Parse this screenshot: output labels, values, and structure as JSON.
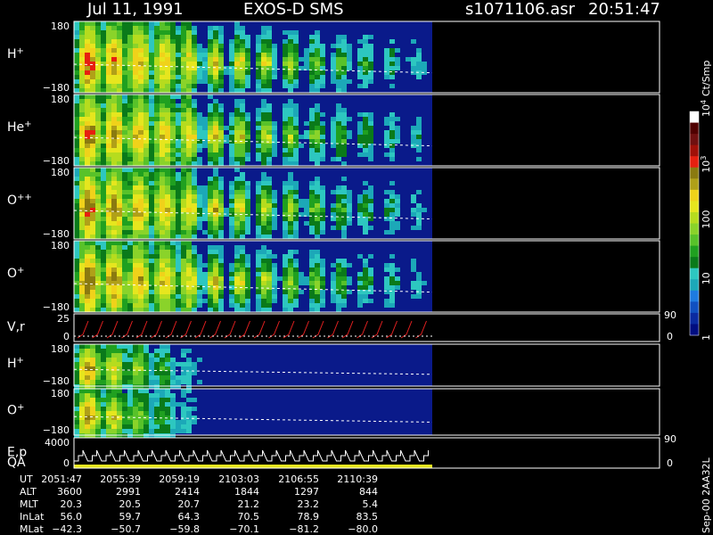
{
  "header": {
    "date": "Jul 11, 1991",
    "instrument": "EXOS-D SMS",
    "file": "s1071106.asr",
    "time": "20:51:47"
  },
  "colorbar": {
    "unit": "Ct/Smp",
    "ticks": [
      {
        "label": "1",
        "value": 1
      },
      {
        "label": "10",
        "value": 10
      },
      {
        "label": "100",
        "value": 100
      },
      {
        "label": "10",
        "sup": "3",
        "value": 1000
      },
      {
        "label": "10",
        "sup": "4",
        "value": 10000
      }
    ],
    "colors": [
      "#000d80",
      "#0a2aa0",
      "#1050c0",
      "#1e7be0",
      "#1ca8b8",
      "#2dc7c0",
      "#0a7a1a",
      "#20a020",
      "#58c22a",
      "#8ad32a",
      "#b6dc1e",
      "#e6e61e",
      "#f0d21a",
      "#b0a018",
      "#8a7a10",
      "#e62010",
      "#a01008",
      "#701010",
      "#500000",
      "#ffffff"
    ]
  },
  "panels": [
    {
      "id": "h-plus",
      "label": "H",
      "sup": "+",
      "ymax": "180",
      "ymin": "−180",
      "type": "spectrogram"
    },
    {
      "id": "he-plus",
      "label": "He",
      "sup": "+",
      "ymax": "180",
      "ymin": "−180",
      "type": "spectrogram"
    },
    {
      "id": "o-plus-plus",
      "label": "O",
      "sup": "++",
      "ymax": "180",
      "ymin": "−180",
      "type": "spectrogram"
    },
    {
      "id": "o-plus",
      "label": "O",
      "sup": "+",
      "ymax": "180",
      "ymin": "−180",
      "type": "spectrogram"
    },
    {
      "id": "vr",
      "label": "V,r",
      "sup": "",
      "ymax": "25",
      "ymin": "0",
      "right_top": "90",
      "right_bottom": "0",
      "type": "line"
    },
    {
      "id": "h-plus-2",
      "label": "H",
      "sup": "+",
      "ymax": "180",
      "ymin": "−180",
      "type": "spectrogram"
    },
    {
      "id": "o-plus-2",
      "label": "O",
      "sup": "+",
      "ymax": "180",
      "ymin": "−180",
      "type": "spectrogram"
    },
    {
      "id": "ep",
      "label": "E,p",
      "label2": "QA",
      "sup": "",
      "ymax": "4000",
      "ymin": "0",
      "right_top": "90",
      "right_bottom": "0",
      "type": "steps"
    }
  ],
  "side_note": "Sep-00 2AA32L",
  "table": {
    "rows": [
      {
        "name": "UT",
        "values": [
          "2051:47",
          "2055:39",
          "2059:19",
          "2103:03",
          "2106:55",
          "2110:39"
        ]
      },
      {
        "name": "ALT",
        "values": [
          "3600",
          "2991",
          "2414",
          "1844",
          "1297",
          "844"
        ]
      },
      {
        "name": "MLT",
        "values": [
          "20.3",
          "20.5",
          "20.7",
          "21.2",
          "23.2",
          "5.4"
        ]
      },
      {
        "name": "InLat",
        "values": [
          "56.0",
          "59.7",
          "64.3",
          "70.5",
          "78.9",
          "83.5"
        ]
      },
      {
        "name": "MLat",
        "values": [
          "−42.3",
          "−50.7",
          "−59.8",
          "−70.1",
          "−81.2",
          "−80.0"
        ]
      }
    ]
  },
  "chart_data": {
    "type": "heatmap",
    "x": [
      "2051:47",
      "2055:39",
      "2059:19",
      "2103:03",
      "2106:55",
      "2110:39"
    ],
    "series": [
      {
        "name": "H+",
        "ylim": [
          -180,
          180
        ]
      },
      {
        "name": "He+",
        "ylim": [
          -180,
          180
        ]
      },
      {
        "name": "O++",
        "ylim": [
          -180,
          180
        ]
      },
      {
        "name": "O+",
        "ylim": [
          -180,
          180
        ]
      },
      {
        "name": "V,r",
        "ylim": [
          0,
          25
        ]
      },
      {
        "name": "H+",
        "ylim": [
          -180,
          180
        ]
      },
      {
        "name": "O+",
        "ylim": [
          -180,
          180
        ]
      },
      {
        "name": "E,p",
        "ylim": [
          0,
          4000
        ]
      }
    ],
    "colorscale": "log",
    "zlim": [
      1,
      10000
    ]
  }
}
